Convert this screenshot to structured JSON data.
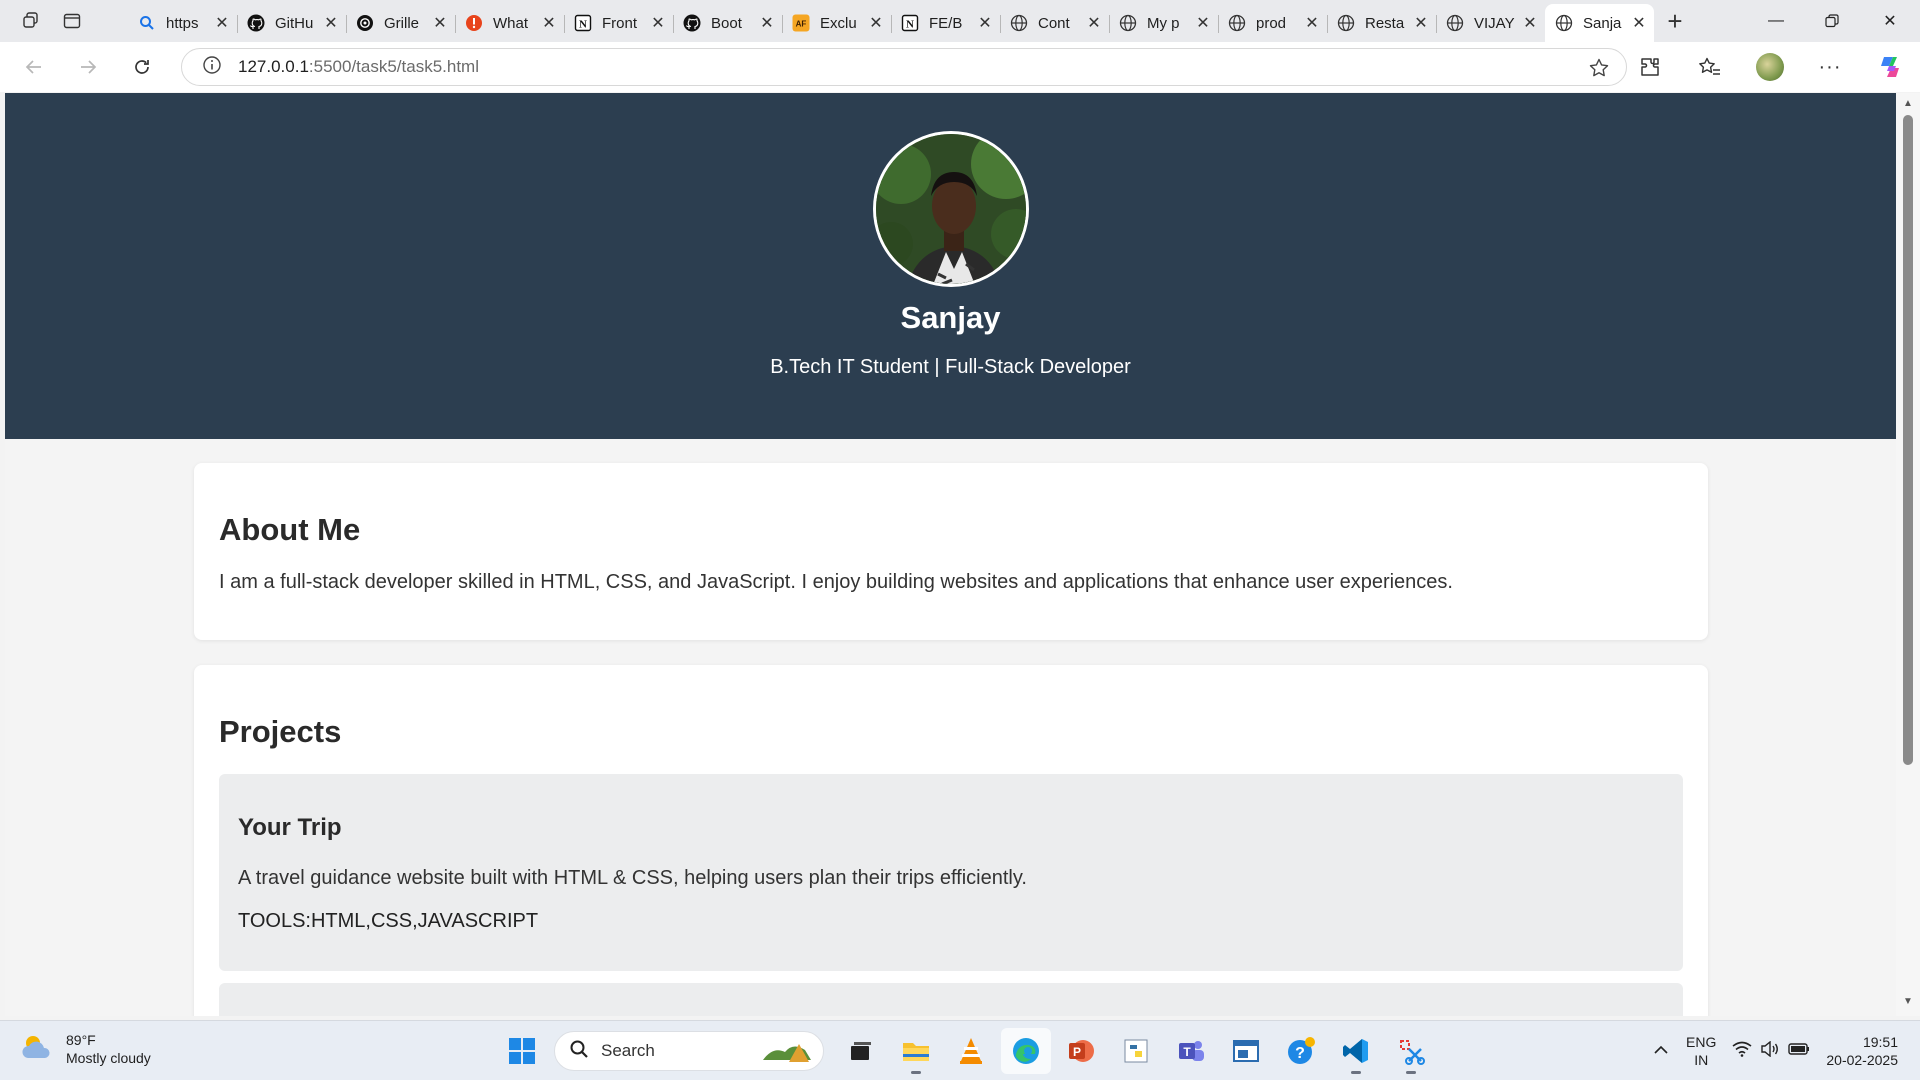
{
  "browser": {
    "tabs": [
      {
        "label": "https",
        "icon": "search-icon",
        "active": false
      },
      {
        "label": "GitHu",
        "icon": "github-icon",
        "active": false
      },
      {
        "label": "Grille",
        "icon": "openai-icon",
        "active": false
      },
      {
        "label": "What",
        "icon": "alert-icon",
        "active": false
      },
      {
        "label": "Front",
        "icon": "notion-icon",
        "active": false
      },
      {
        "label": "Boot",
        "icon": "github-icon",
        "active": false
      },
      {
        "label": "Exclu",
        "icon": "af-icon",
        "active": false
      },
      {
        "label": "FE/B",
        "icon": "notion-icon",
        "active": false
      },
      {
        "label": "Cont",
        "icon": "globe-icon",
        "active": false
      },
      {
        "label": "My p",
        "icon": "globe-icon",
        "active": false
      },
      {
        "label": "prod",
        "icon": "globe-icon",
        "active": false
      },
      {
        "label": "Resta",
        "icon": "globe-icon",
        "active": false
      },
      {
        "label": "VIJAY",
        "icon": "globe-icon",
        "active": false
      },
      {
        "label": "Sanja",
        "icon": "globe-icon",
        "active": true
      }
    ],
    "address": {
      "host": "127.0.0.1",
      "rest": ":5500/task5/task5.html"
    }
  },
  "page": {
    "name": "Sanjay",
    "subtitle": "B.Tech IT Student | Full-Stack Developer",
    "about": {
      "heading": "About Me",
      "text": "I am a full-stack developer skilled in HTML, CSS, and JavaScript. I enjoy building websites and applications that enhance user experiences."
    },
    "projects": {
      "heading": "Projects",
      "items": [
        {
          "title": "Your Trip",
          "description": "A travel guidance website built with HTML & CSS, helping users plan their trips efficiently.",
          "tools": "TOOLS:HTML,CSS,JAVASCRIPT"
        }
      ]
    }
  },
  "taskbar": {
    "weather": {
      "temp": "89°F",
      "condition": "Mostly cloudy"
    },
    "search_label": "Search",
    "lang": {
      "line1": "ENG",
      "line2": "IN"
    },
    "time": "19:51",
    "date": "20-02-2025"
  },
  "colors": {
    "hero_bg": "#2c3e50",
    "project_bg": "#ecedee",
    "accent": "#0067c0"
  }
}
